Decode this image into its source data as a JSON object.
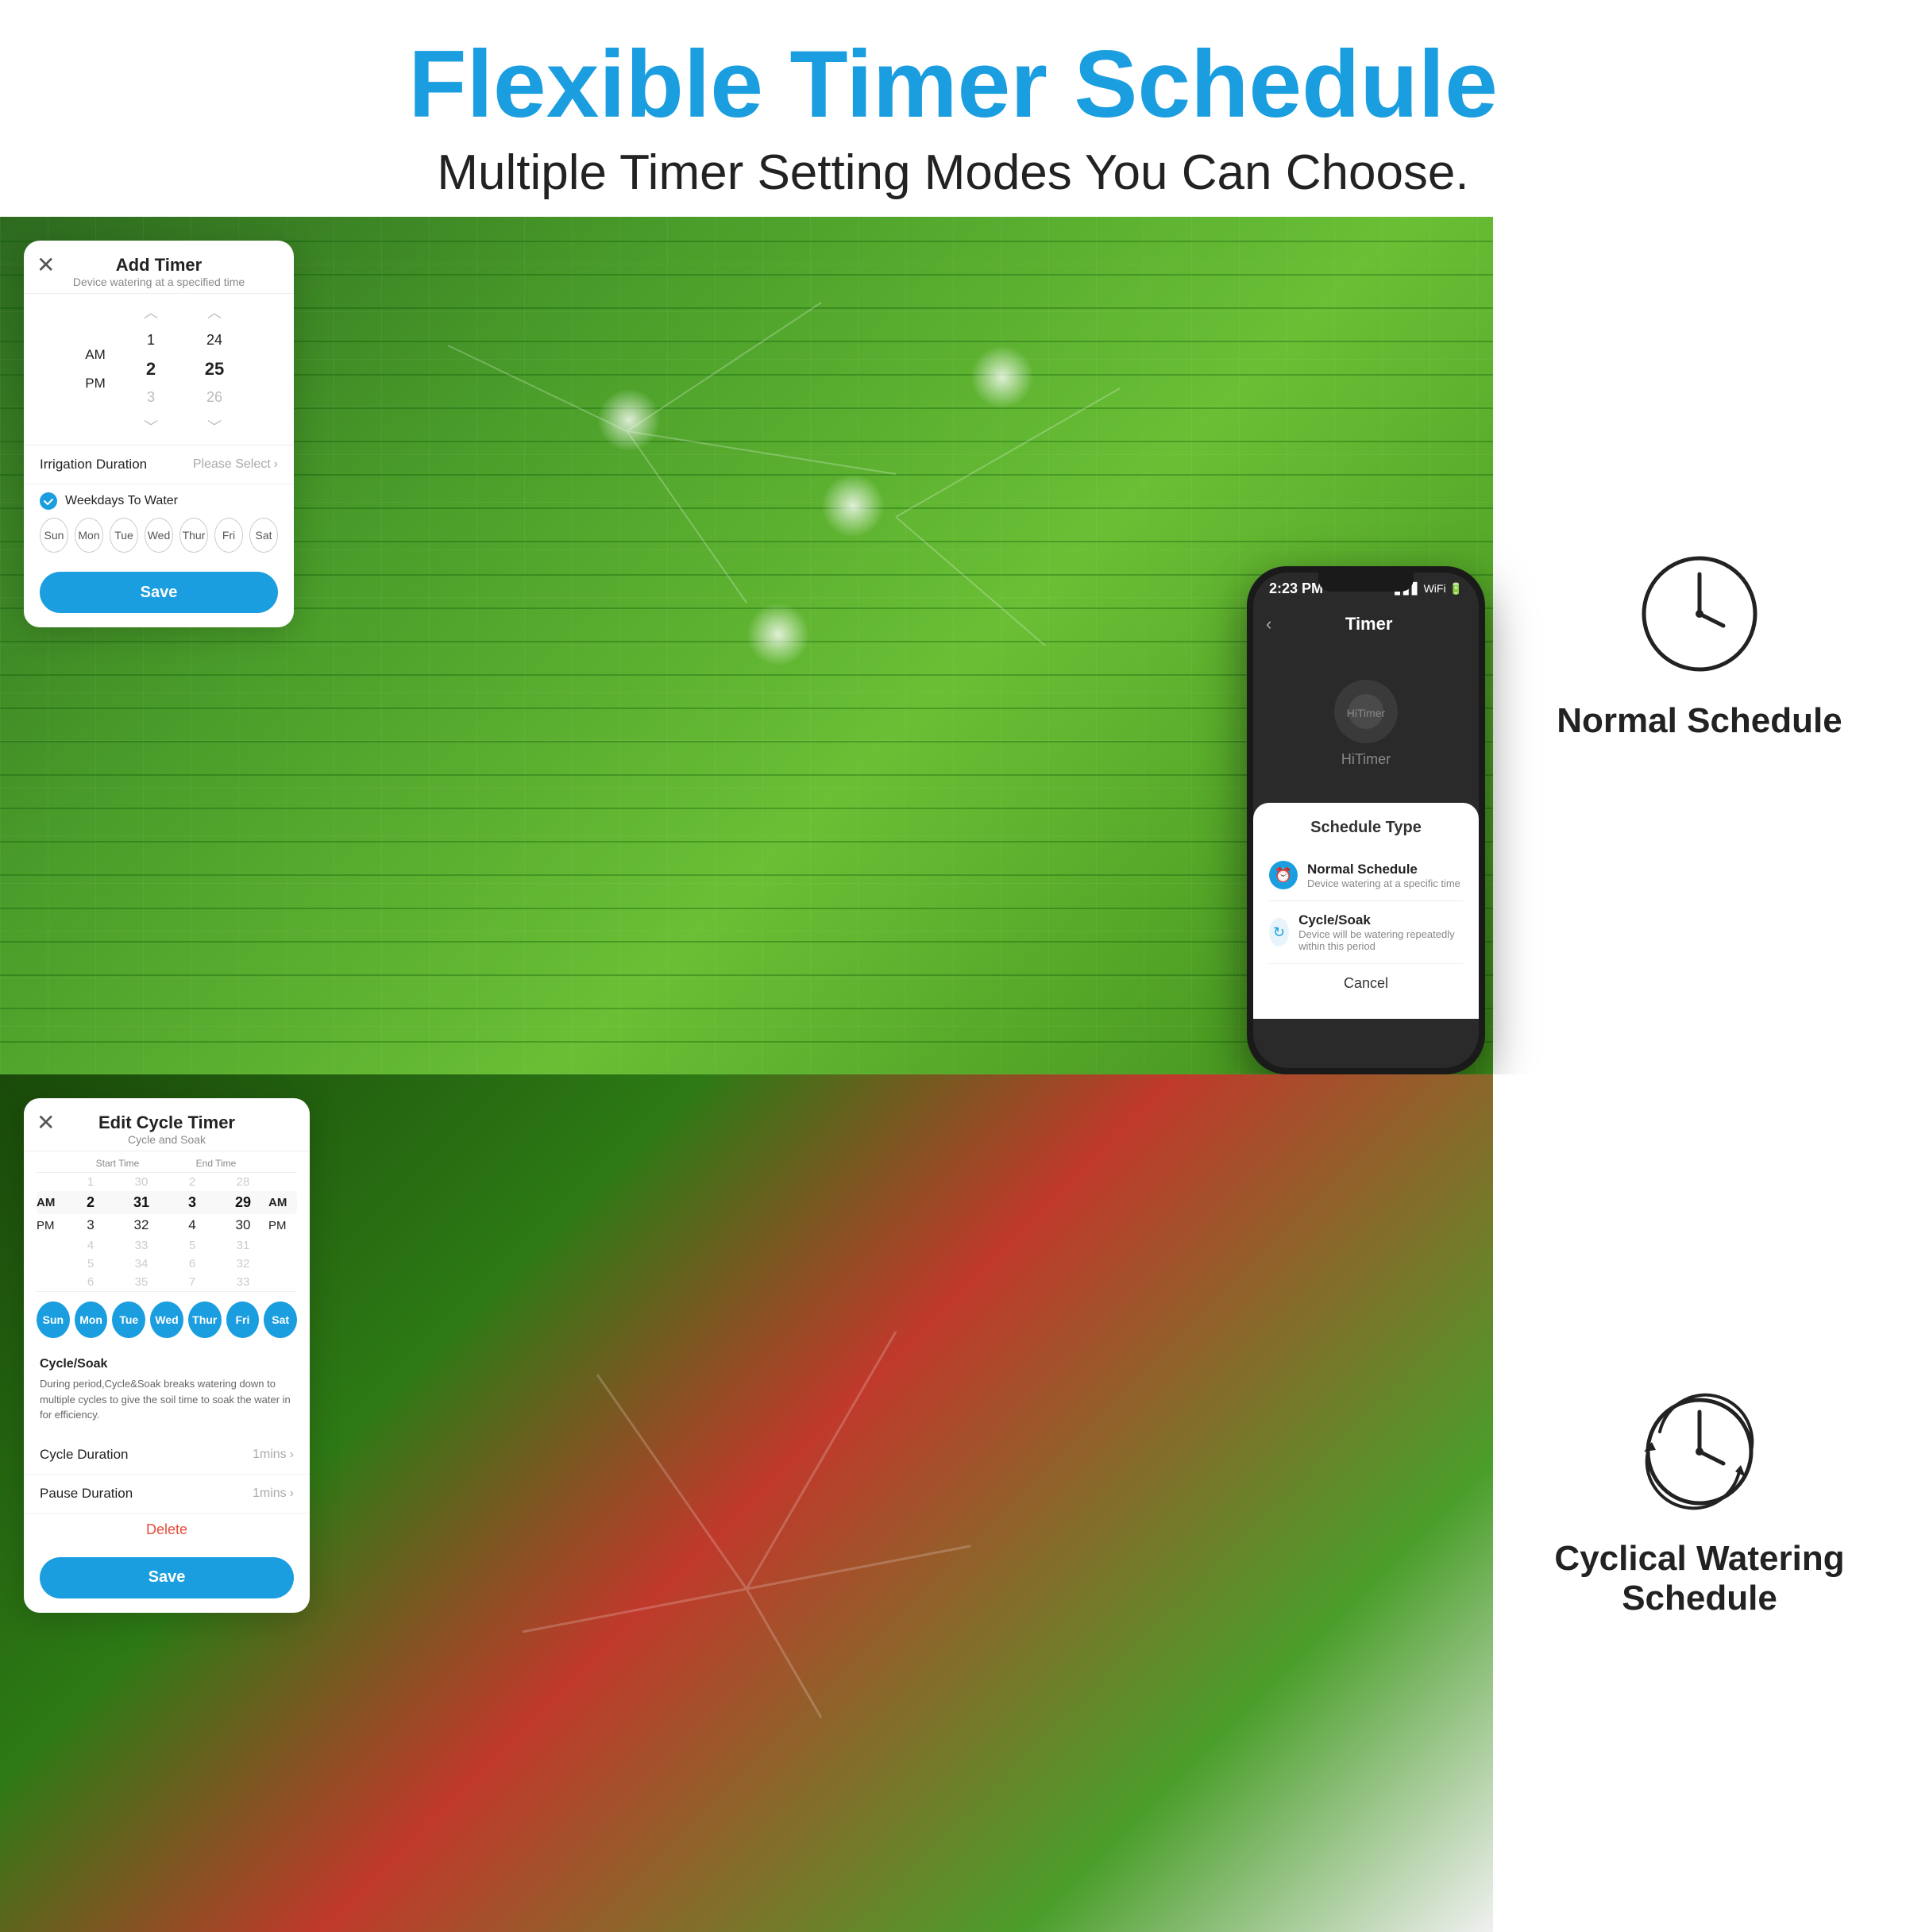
{
  "header": {
    "main_title": "Flexible Timer Schedule",
    "sub_title": "Multiple Timer Setting Modes You Can Choose."
  },
  "top_dialog": {
    "close_symbol": "✕",
    "title": "Add Timer",
    "subtitle": "Device watering at a specified time",
    "time_picker": {
      "rows": [
        {
          "ampm": "",
          "hour": "",
          "minute": ""
        },
        {
          "ampm": "AM",
          "hour": "1",
          "minute": "24"
        },
        {
          "ampm": "PM",
          "hour": "2",
          "minute": "25"
        },
        {
          "ampm": "",
          "hour": "3",
          "minute": "26"
        }
      ],
      "up_arrow": "︿",
      "down_arrow": "﹀"
    },
    "irrigation_label": "Irrigation Duration",
    "irrigation_value": "Please Select",
    "irrigation_arrow": "›",
    "weekdays_check_label": "Weekdays To Water",
    "days": [
      {
        "label": "Sun",
        "active": false
      },
      {
        "label": "Mon",
        "active": false
      },
      {
        "label": "Tue",
        "active": false
      },
      {
        "label": "Wed",
        "active": false
      },
      {
        "label": "Thur",
        "active": false
      },
      {
        "label": "Fri",
        "active": false
      },
      {
        "label": "Sat",
        "active": false
      }
    ],
    "save_label": "Save"
  },
  "phone": {
    "status_time": "2:23 PM",
    "signal_icons": "▋▋▋ WiFi 🔋",
    "nav_back": "‹",
    "nav_title": "Timer",
    "hi_timer_label": "HiTimer",
    "modal": {
      "title": "Schedule Type",
      "options": [
        {
          "icon": "⏰",
          "title": "Normal Schedule",
          "desc": "Device watering  at a specific time"
        },
        {
          "icon": "🔄",
          "title": "Cycle/Soak",
          "desc": "Device will be watering repeatedly within this period"
        }
      ],
      "cancel_label": "Cancel"
    }
  },
  "right_panel_top": {
    "label": "Normal Schedule"
  },
  "right_panel_bottom": {
    "label1": "Cyclical Watering",
    "label2": "Schedule"
  },
  "bottom_dialog": {
    "close_symbol": "✕",
    "title": "Edit Cycle Timer",
    "subtitle": "Cycle and Soak",
    "col_headers": [
      "",
      "Start Time",
      "",
      "End Time",
      ""
    ],
    "picker_rows": [
      {
        "c1": "",
        "c2": "1",
        "c3": "30",
        "c4": "2",
        "c5": "28",
        "c6": ""
      },
      {
        "c1": "AM",
        "c2": "2",
        "c3": "31",
        "c4": "3",
        "c5": "29",
        "c6": "AM"
      },
      {
        "c1": "PM",
        "c2": "3",
        "c3": "32",
        "c4": "4",
        "c5": "30",
        "c6": "PM"
      },
      {
        "c1": "",
        "c2": "4",
        "c3": "33",
        "c4": "5",
        "c5": "31",
        "c6": ""
      },
      {
        "c1": "",
        "c2": "5",
        "c3": "34",
        "c4": "6",
        "c5": "32",
        "c6": ""
      },
      {
        "c1": "",
        "c2": "6",
        "c3": "35",
        "c4": "7",
        "c5": "33",
        "c6": ""
      }
    ],
    "days": [
      {
        "label": "Sun",
        "active": true
      },
      {
        "label": "Mon",
        "active": true
      },
      {
        "label": "Tue",
        "active": true
      },
      {
        "label": "Wed",
        "active": true
      },
      {
        "label": "Thur",
        "active": true
      },
      {
        "label": "Fri",
        "active": true
      },
      {
        "label": "Sat",
        "active": true
      }
    ],
    "cycle_soak_title": "Cycle/Soak",
    "cycle_soak_desc": "During period,Cycle&Soak breaks watering down to multiple cycles to give the soil time to soak the water in for efficiency.",
    "cycle_duration_label": "Cycle Duration",
    "cycle_duration_value": "1mins",
    "pause_duration_label": "Pause  Duration",
    "pause_duration_value": "1mins",
    "arrow": "›",
    "delete_label": "Delete",
    "save_label": "Save"
  }
}
